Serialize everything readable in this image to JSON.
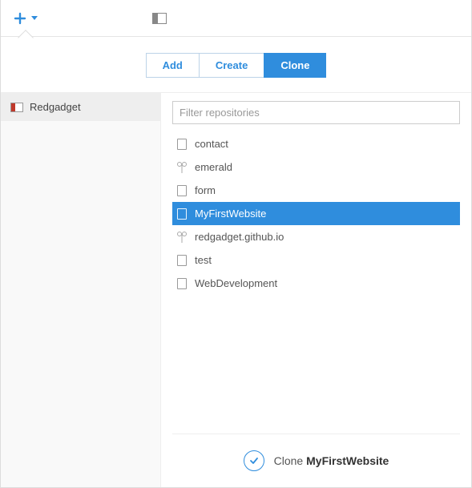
{
  "buttons": {
    "add": "Add",
    "create": "Create",
    "clone": "Clone",
    "active": "clone"
  },
  "sidebar": {
    "account": {
      "name": "Redgadget"
    }
  },
  "filter": {
    "placeholder": "Filter repositories",
    "value": ""
  },
  "repos": [
    {
      "name": "contact",
      "icon": "repo",
      "selected": false
    },
    {
      "name": "emerald",
      "icon": "fork",
      "selected": false
    },
    {
      "name": "form",
      "icon": "repo",
      "selected": false
    },
    {
      "name": "MyFirstWebsite",
      "icon": "repo",
      "selected": true
    },
    {
      "name": "redgadget.github.io",
      "icon": "fork",
      "selected": false
    },
    {
      "name": "test",
      "icon": "repo",
      "selected": false
    },
    {
      "name": "WebDevelopment",
      "icon": "repo",
      "selected": false
    }
  ],
  "footer": {
    "action": "Clone",
    "target": "MyFirstWebsite"
  }
}
